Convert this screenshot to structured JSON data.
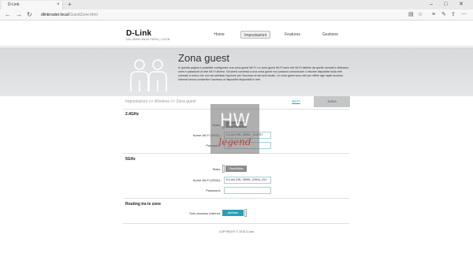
{
  "browser": {
    "tab_title": "D-Link",
    "tab_close": "×",
    "new_tab": "+",
    "url_host": "dlinkrouter.local",
    "url_path": "/GuestZone.html",
    "icons": [
      "back-icon",
      "forward-icon",
      "refresh-icon",
      "reading-view-icon",
      "favorite-icon",
      "favorites-hub-icon",
      "notes-icon",
      "share-icon",
      "more-icon"
    ]
  },
  "header": {
    "logo": "D-Link",
    "model": "DSL-3590L   HW:A1   FW:EU_1.00.06",
    "nav": [
      "Home",
      "Impostazioni",
      "Features",
      "Gestione"
    ],
    "active_nav": "Impostazioni"
  },
  "banner": {
    "title": "Zona guest",
    "description": "In questa pagina è possibile configurare una zona guest Wi-Fi. Le zone guest Wi-Fi sono reti Wi-Fi distinte da quelle normali e utilizzano nomi e password di rete Wi-Fi diversi. Gli utenti connessi a una zona guest non possono comunicare o rilevare dispositivi sulla rete normale a meno che non sia abilitata l'opzione per l'accesso al servizio locale. Le zone guest sono utili per offrire agli ospiti accesso Internet senza consentire l'accesso ai dispositivi disponibili in rete."
  },
  "breadcrumb": "Impostazioni >> Wireless >> Zona guest",
  "subtabs": {
    "wifi": "Wi-Fi",
    "save": "Salva"
  },
  "band_24": {
    "title": "2.4GHz",
    "stato_label": "Stato:",
    "stato_value": "Disabilitato",
    "ssid_label": "Nome Wi-Fi (SSID):",
    "ssid_value": "D-Link DSL-3590L_GUEST",
    "password_label": "Password:",
    "password_value": ""
  },
  "band_5": {
    "title": "5GHz",
    "stato_label": "Stato:",
    "stato_value": "Disabilitato",
    "ssid_label": "Nome Wi-Fi (SSID):",
    "ssid_value": "D-Link DSL-3590L_5GHz_GU",
    "password_label": "Password:",
    "password_value": ""
  },
  "routing": {
    "title": "Routing tra le zone",
    "label": "Solo accesso Internet:",
    "value": "Abilitato"
  },
  "footer": "COPYRIGHT © 2016 D-Link",
  "watermark": {
    "top": "HW",
    "bottom": "legend"
  },
  "colors": {
    "accent": "#2a9fb3",
    "banner": "#dcdedf",
    "disabled": "#8c8c8c"
  }
}
